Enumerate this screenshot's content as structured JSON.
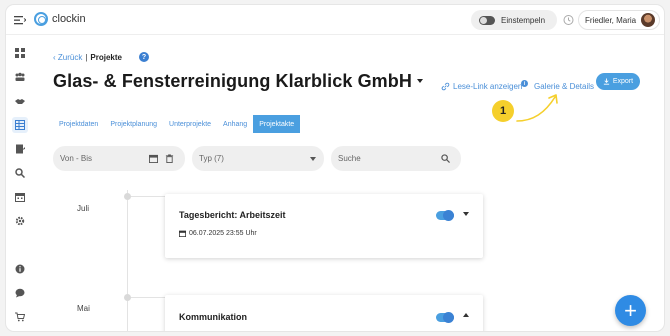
{
  "app": {
    "name": "clockin"
  },
  "topbar": {
    "clock_label": "Einstempeln",
    "user_name": "Friedler, Maria"
  },
  "breadcrumb": {
    "back_label": "Zurück",
    "separator": "|",
    "current": "Projekte"
  },
  "page": {
    "title": "Glas- & Fensterreinigung Klarblick GmbH"
  },
  "actions": {
    "read_link": "Lese-Link anzeigen",
    "info_icon": "i",
    "gallery": "Galerie & Details",
    "export": "Export"
  },
  "annotation": {
    "badge": "1"
  },
  "tabs": [
    {
      "label": "Projektdaten"
    },
    {
      "label": "Projektplanung"
    },
    {
      "label": "Unterprojekte"
    },
    {
      "label": "Anhang"
    },
    {
      "label": "Projektakte",
      "active": true
    }
  ],
  "filters": {
    "date_placeholder": "Von - Bis",
    "type_label": "Typ (7)",
    "search_placeholder": "Suche"
  },
  "timeline": [
    {
      "month": "Juli",
      "card_title": "Tagesbericht: Arbeitszeit",
      "card_date": "06.07.2025 23:55 Uhr",
      "enabled": true,
      "expanded": false
    },
    {
      "month": "Mai",
      "card_title": "Kommunikation",
      "card_date": "",
      "enabled": true,
      "expanded": true
    }
  ],
  "fab": {
    "label": "+"
  },
  "colors": {
    "accent": "#4a9fe0",
    "link": "#4a8fd8",
    "badge": "#f5cf2c"
  },
  "icons": {
    "sidebar": [
      "dashboard-icon",
      "team-icon",
      "handshake-icon",
      "projects-icon",
      "reports-icon",
      "search-icon",
      "calendar-icon",
      "settings-icon",
      "info-icon",
      "chat-icon",
      "cart-icon"
    ]
  }
}
